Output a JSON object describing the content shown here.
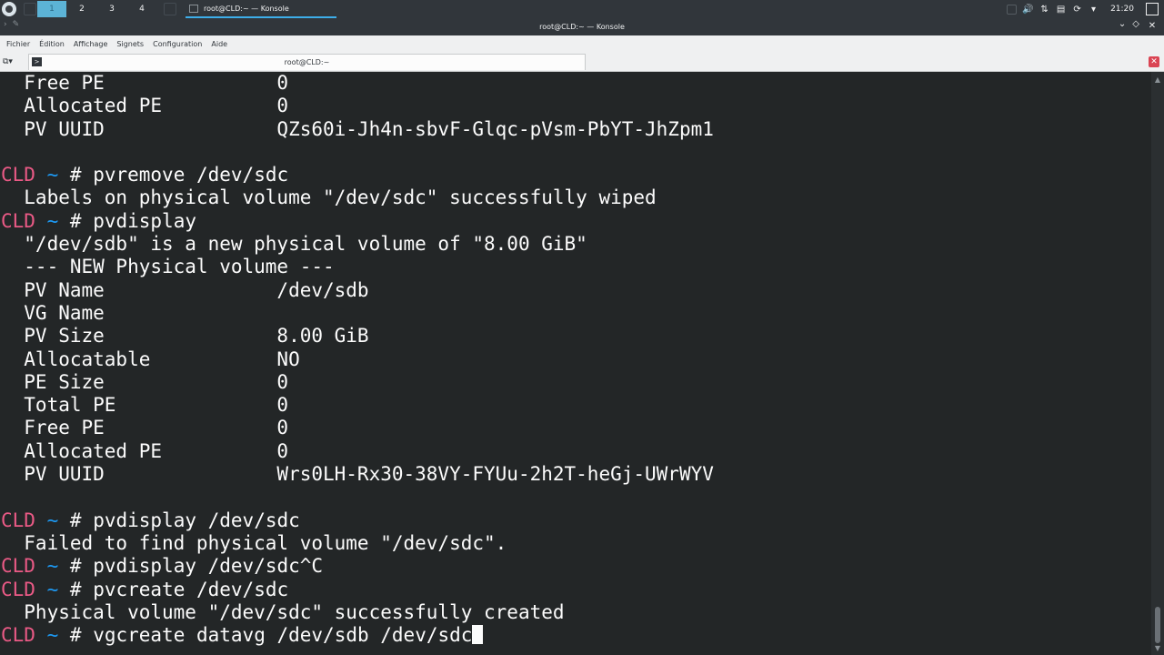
{
  "panel": {
    "desktops": [
      "1",
      "2",
      "3",
      "4"
    ],
    "task_title": "root@CLD:~ — Konsole",
    "clock": "21:20"
  },
  "window": {
    "title": "root@CLD:~ — Konsole"
  },
  "menubar": {
    "items": [
      "Fichier",
      "Édition",
      "Affichage",
      "Signets",
      "Configuration",
      "Aide"
    ]
  },
  "tabs": {
    "active_label": "root@CLD:~"
  },
  "terminal": {
    "lines": [
      {
        "text": "  Free PE               0"
      },
      {
        "text": "  Allocated PE          0"
      },
      {
        "text": "  PV UUID               QZs60i-Jh4n-sbvF-Glqc-pVsm-PbYT-JhZpm1"
      },
      {
        "text": ""
      },
      {
        "host": "CLD",
        "dir": "~",
        "cmd": "pvremove /dev/sdc"
      },
      {
        "text": "  Labels on physical volume \"/dev/sdc\" successfully wiped"
      },
      {
        "host": "CLD",
        "dir": "~",
        "cmd": "pvdisplay"
      },
      {
        "text": "  \"/dev/sdb\" is a new physical volume of \"8.00 GiB\""
      },
      {
        "text": "  --- NEW Physical volume ---"
      },
      {
        "text": "  PV Name               /dev/sdb"
      },
      {
        "text": "  VG Name"
      },
      {
        "text": "  PV Size               8.00 GiB"
      },
      {
        "text": "  Allocatable           NO"
      },
      {
        "text": "  PE Size               0"
      },
      {
        "text": "  Total PE              0"
      },
      {
        "text": "  Free PE               0"
      },
      {
        "text": "  Allocated PE          0"
      },
      {
        "text": "  PV UUID               Wrs0LH-Rx30-38VY-FYUu-2h2T-heGj-UWrWYV"
      },
      {
        "text": ""
      },
      {
        "host": "CLD",
        "dir": "~",
        "cmd": "pvdisplay /dev/sdc"
      },
      {
        "text": "  Failed to find physical volume \"/dev/sdc\"."
      },
      {
        "host": "CLD",
        "dir": "~",
        "cmd": "pvdisplay /dev/sdc^C"
      },
      {
        "host": "CLD",
        "dir": "~",
        "cmd": "pvcreate /dev/sdc"
      },
      {
        "text": "  Physical volume \"/dev/sdc\" successfully created"
      },
      {
        "host": "CLD",
        "dir": "~",
        "cmd": "vgcreate datavg /dev/sdb /dev/sdc",
        "cursor": true
      }
    ]
  },
  "colors": {
    "prompt_host": "#eb5a86",
    "prompt_dir": "#1d99f3",
    "terminal_bg": "#232627",
    "terminal_fg": "#fcfcfc",
    "accent": "#3daee9"
  }
}
